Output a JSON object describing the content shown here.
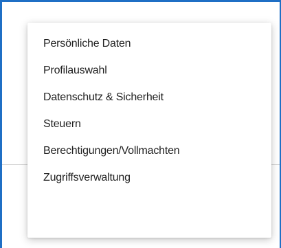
{
  "menu": {
    "items": [
      {
        "label": "Persönliche Daten"
      },
      {
        "label": "Profilauswahl"
      },
      {
        "label": "Datenschutz & Sicherheit"
      },
      {
        "label": "Steuern"
      },
      {
        "label": "Berechtigungen/Vollmachten"
      },
      {
        "label": "Zugriffsverwaltung"
      }
    ]
  },
  "colors": {
    "frame_border": "#1f6fc5",
    "text": "#222222",
    "divider": "#d8d8d8"
  }
}
